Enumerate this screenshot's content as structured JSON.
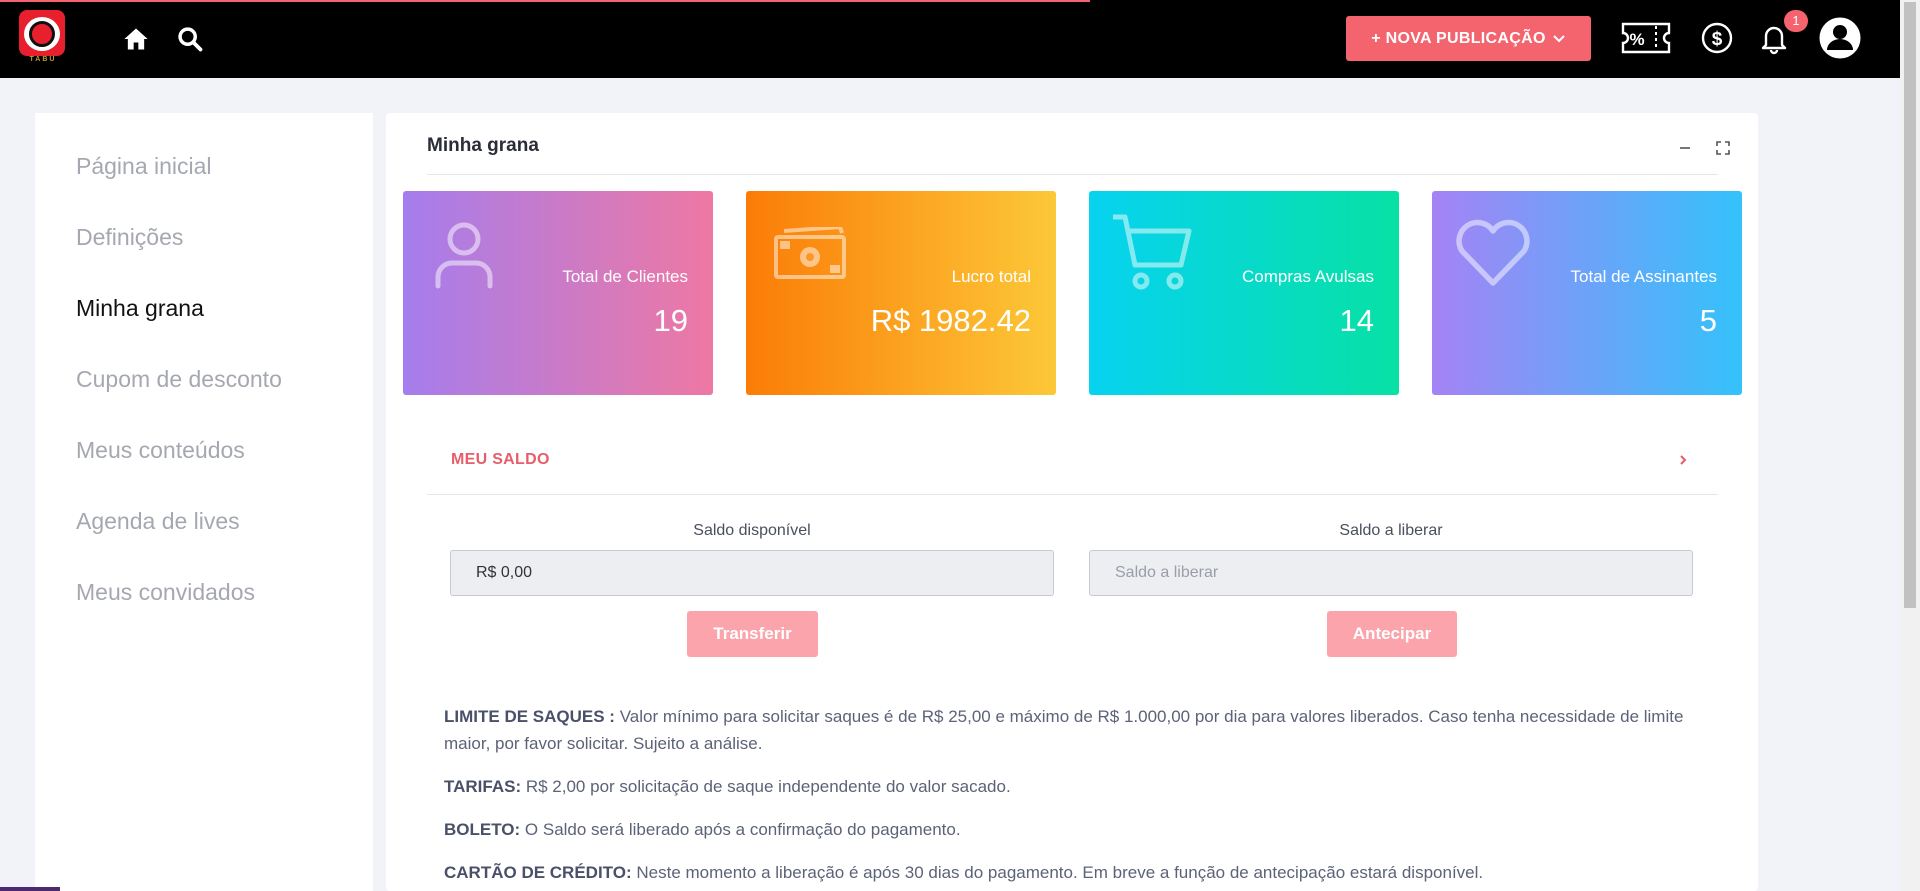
{
  "header": {
    "logo_text": "TABU",
    "new_publication_label": "+ NOVA PUBLICAÇÃO",
    "notification_count": "1",
    "icons": [
      "home-icon",
      "search-icon",
      "coupon-icon",
      "dollar-icon",
      "bell-icon",
      "user-avatar-icon"
    ]
  },
  "sidebar": {
    "items": [
      {
        "label": "Página inicial",
        "active": false
      },
      {
        "label": "Definições",
        "active": false
      },
      {
        "label": "Minha grana",
        "active": true
      },
      {
        "label": "Cupom de desconto",
        "active": false
      },
      {
        "label": "Meus conteúdos",
        "active": false
      },
      {
        "label": "Agenda de lives",
        "active": false
      },
      {
        "label": "Meus convidados",
        "active": false
      }
    ]
  },
  "main": {
    "title": "Minha grana",
    "stats": [
      {
        "label": "Total de Clientes",
        "value": "19",
        "icon": "user-icon"
      },
      {
        "label": "Lucro total",
        "value": "R$ 1982.42",
        "icon": "money-icon"
      },
      {
        "label": "Compras Avulsas",
        "value": "14",
        "icon": "cart-icon"
      },
      {
        "label": "Total de Assinantes",
        "value": "5",
        "icon": "heart-icon"
      }
    ],
    "saldo": {
      "heading": "MEU SALDO",
      "available_label": "Saldo disponível",
      "available_value": "R$ 0,00",
      "release_label": "Saldo a liberar",
      "release_placeholder": "Saldo a liberar",
      "transfer_label": "Transferir",
      "anticipate_label": "Antecipar"
    },
    "info": [
      {
        "title": "LIMITE DE SAQUES :",
        "text": " Valor mínimo para solicitar saques é de R$ 25,00 e máximo de R$ 1.000,00 por dia para valores liberados. Caso tenha necessidade de limite maior, por favor solicitar. Sujeito a análise."
      },
      {
        "title": "TARIFAS:",
        "text": " R$ 2,00 por solicitação de saque independente do valor sacado."
      },
      {
        "title": "BOLETO:",
        "text": " O Saldo será liberado após a confirmação do pagamento."
      },
      {
        "title": "CARTÃO DE CRÉDITO:",
        "text": " Neste momento a liberação é após 30 dias do pagamento. Em breve a função de antecipação estará disponível."
      }
    ]
  },
  "colors": {
    "accent": "#f4646e",
    "topbar": "#000000",
    "saldo_heading": "#e65d6b"
  }
}
